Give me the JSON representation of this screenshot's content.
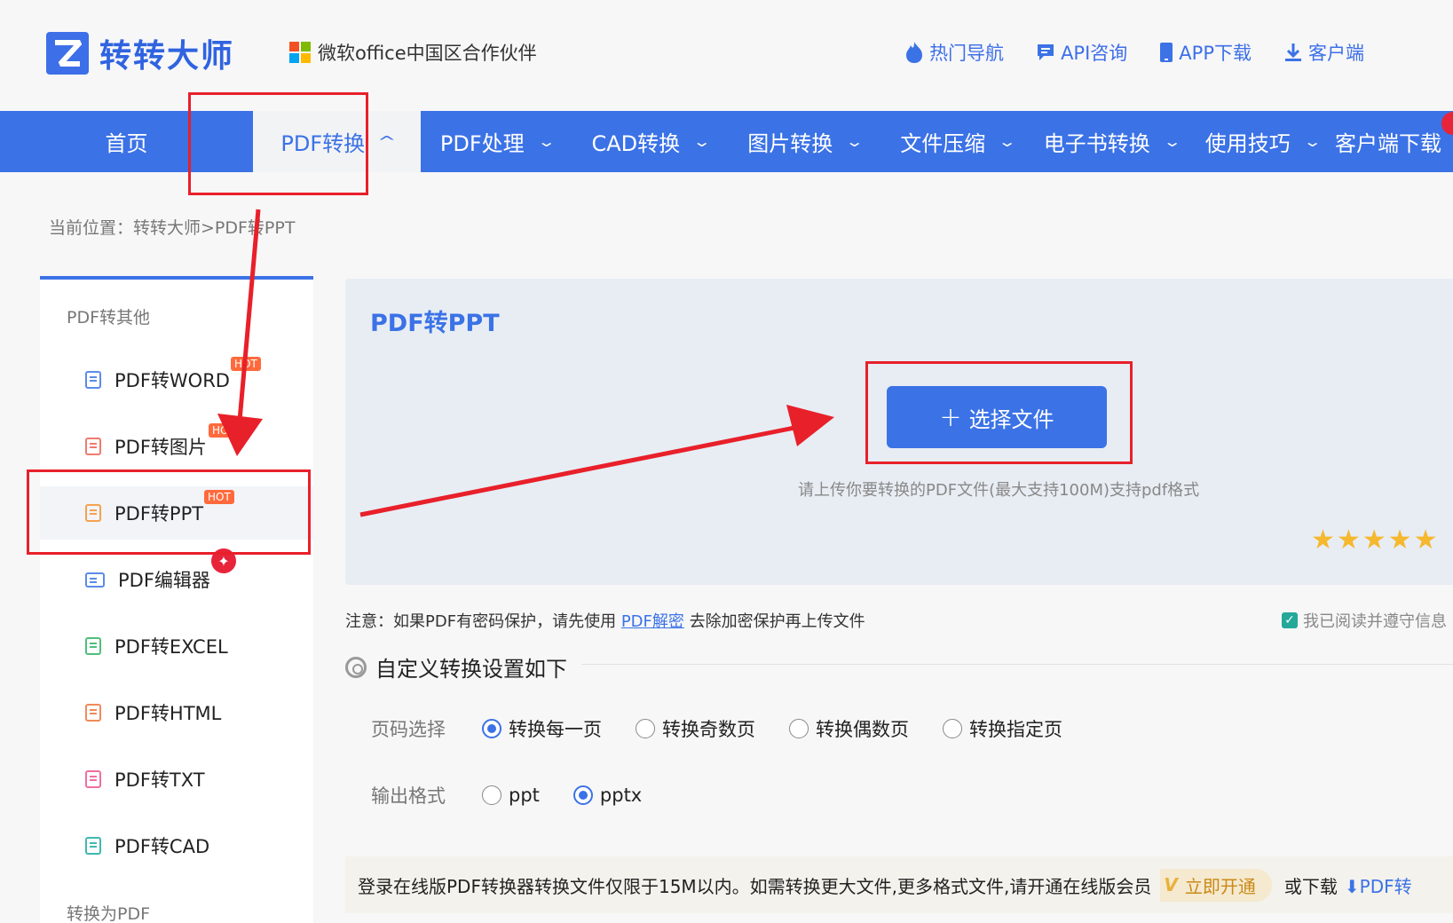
{
  "header": {
    "logo_text": "转转大师",
    "partner_text": "微软office中国区合作伙伴",
    "links": [
      {
        "label": "热门导航",
        "icon": "fire-icon"
      },
      {
        "label": "API咨询",
        "icon": "chat-icon"
      },
      {
        "label": "APP下载",
        "icon": "phone-icon"
      },
      {
        "label": "客户端",
        "icon": "download-icon"
      }
    ]
  },
  "nav": {
    "items": [
      {
        "label": "首页"
      },
      {
        "label": "PDF转换",
        "chevron": "^",
        "active": true
      },
      {
        "label": "PDF处理",
        "chevron": "⌄"
      },
      {
        "label": "CAD转换",
        "chevron": "⌄"
      },
      {
        "label": "图片转换",
        "chevron": "⌄"
      },
      {
        "label": "文件压缩",
        "chevron": "⌄"
      },
      {
        "label": "电子书转换",
        "chevron": "⌄"
      },
      {
        "label": "使用技巧",
        "chevron": "⌄"
      },
      {
        "label": "客户端下载",
        "chevron": "⌄"
      }
    ]
  },
  "breadcrumb": "当前位置：转转大师>PDF转PPT",
  "sidebar": {
    "group1": "PDF转其他",
    "group2": "转换为PDF",
    "items": [
      {
        "label": "PDF转WORD",
        "badge": "HOT"
      },
      {
        "label": "PDF转图片",
        "badge": "HOT"
      },
      {
        "label": "PDF转PPT",
        "badge": "HOT"
      },
      {
        "label": "PDF编辑器"
      },
      {
        "label": "PDF转EXCEL"
      },
      {
        "label": "PDF转HTML"
      },
      {
        "label": "PDF转TXT"
      },
      {
        "label": "PDF转CAD"
      }
    ]
  },
  "main": {
    "title": "PDF转PPT",
    "select_button": "选择文件",
    "select_plus": "+",
    "upload_hint": "请上传你要转换的PDF文件(最大支持100M)支持pdf格式",
    "stars": "★★★★★",
    "notice_prefix": "注意：如果PDF有密码保护，请先使用",
    "notice_link": "PDF解密",
    "notice_suffix": "去除加密保护再上传文件",
    "agree_text": "我已阅读并遵守信息",
    "settings_title": "自定义转换设置如下",
    "page_label": "页码选择",
    "page_options": [
      "转换每一页",
      "转换奇数页",
      "转换偶数页",
      "转换指定页"
    ],
    "page_selected": 0,
    "format_label": "输出格式",
    "format_options": [
      "ppt",
      "pptx"
    ],
    "format_selected": 1,
    "bottom_text": "登录在线版PDF转换器转换文件仅限于15M以内。如需转换更大文件,更多格式文件,请开通在线版会员",
    "vip_icon": "V",
    "vip_button": "立即开通",
    "or_download": "或下载",
    "download_link": "PDF转"
  },
  "colors": {
    "brand": "#3b72e6",
    "annotation": "#e8202a",
    "hot": "#ff6a3c"
  }
}
